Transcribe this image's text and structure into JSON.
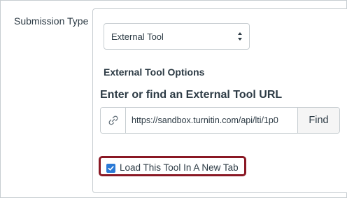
{
  "submission": {
    "label": "Submission Type",
    "selected": "External Tool"
  },
  "external_tool": {
    "options_heading": "External Tool Options",
    "url_heading": "Enter or find an External Tool URL",
    "url_value": "https://sandbox.turnitin.com/api/lti/1p0",
    "find_label": "Find",
    "link_icon": "link-icon",
    "new_tab_label": "Load This Tool In A New Tab",
    "new_tab_checked": true
  },
  "colors": {
    "highlight": "#8a1824",
    "checkbox": "#2b7ad6",
    "text": "#2d3b45",
    "border": "#c7cdd1"
  }
}
